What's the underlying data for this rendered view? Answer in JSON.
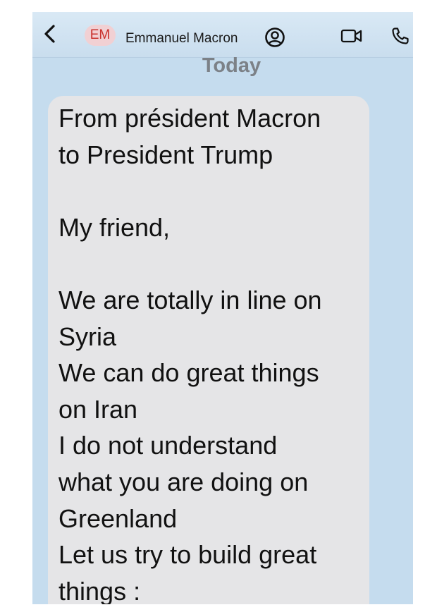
{
  "header": {
    "avatar_initials": "EM",
    "contact_name": "Emmanuel Macron",
    "icons": {
      "back": "chevron-left-icon",
      "contact": "person-circle-icon",
      "video": "video-camera-icon",
      "call": "phone-icon"
    }
  },
  "conversation": {
    "date_label": "Today",
    "message": "From président Macron\nto President Trump\n\nMy friend,\n\nWe are totally in line on\nSyria\nWe can do great things\non Iran\nI do not understand\nwhat you are doing on\nGreenland\nLet us try to build great\nthings :"
  },
  "colors": {
    "background": "#c5dcee",
    "bubble": "#e5e5e7",
    "avatar_bg": "#f1d0d3",
    "avatar_text": "#c9302c",
    "date_text": "#7c8187"
  }
}
